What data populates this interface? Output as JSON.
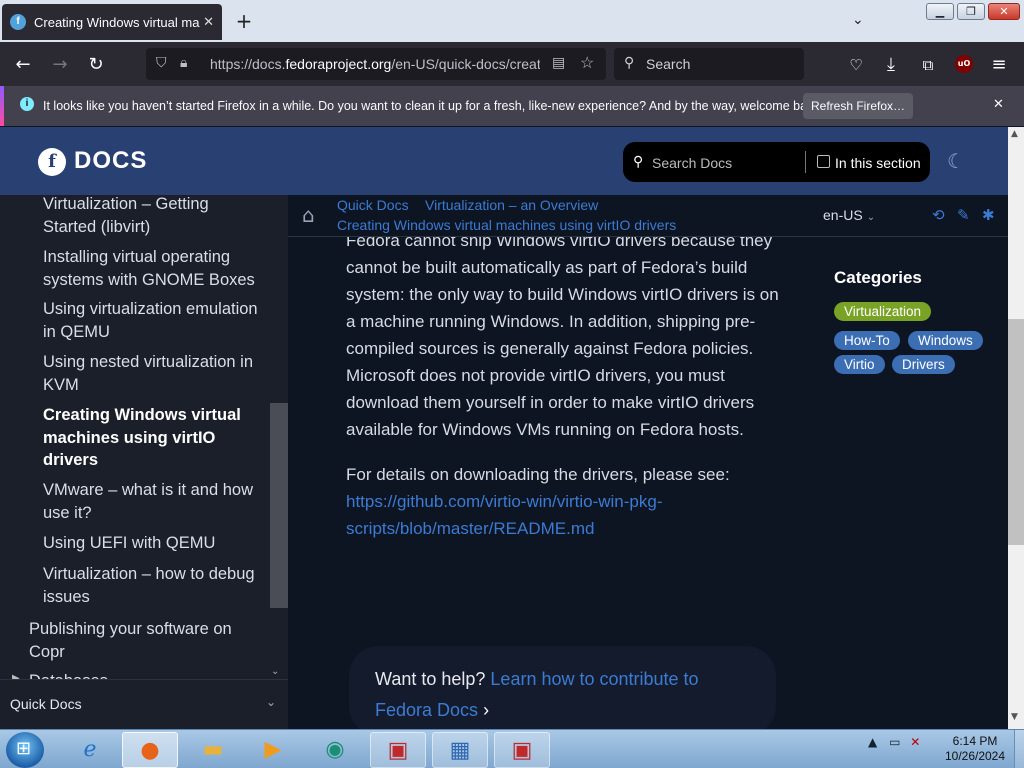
{
  "browser": {
    "tab_title": "Creating Windows virtual machines using virtIO drivers",
    "new_tab": "+",
    "url_prefix": "https://docs.",
    "url_domain": "fedoraproject.org",
    "url_rest": "/en-US/quick-docs/creating-windows-virtual-machines-using-virtio-drivers/",
    "search_placeholder": "Search",
    "ublock_label": "uO"
  },
  "notification": {
    "message": "It looks like you haven’t started Firefox in a while. Do you want to clean it up for a fresh, like-new experience? And by the way, welcome back!",
    "button": "Refresh Firefox…"
  },
  "site": {
    "logo_text": "DOCS",
    "search_placeholder": "Search Docs",
    "in_section_label": "In this section"
  },
  "sidebar": {
    "items": [
      {
        "label": "Virtualization – Getting Started (libvirt)"
      },
      {
        "label": "Installing virtual operating systems with GNOME Boxes"
      },
      {
        "label": "Using virtualization emulation in QEMU"
      },
      {
        "label": "Using nested virtualization in KVM"
      },
      {
        "label": "Creating Windows virtual machines using virtIO drivers"
      },
      {
        "label": "VMware – what is it and how use it?"
      },
      {
        "label": "Using UEFI with QEMU"
      },
      {
        "label": "Virtualization – how to debug issues"
      },
      {
        "label": "Publishing your software on Copr"
      },
      {
        "label": "Databases"
      }
    ],
    "footer_label": "Quick Docs"
  },
  "breadcrumb": {
    "items": [
      "Quick Docs",
      "Virtualization – an Overview",
      "Creating Windows virtual machines using virtIO drivers"
    ],
    "language": "en-US"
  },
  "article": {
    "paragraph1": "Fedora cannot ship Windows virtIO drivers because they cannot be built automatically as part of Fedora’s build system: the only way to build Windows virtIO drivers is on a machine running Windows. In addition, shipping pre-compiled sources is generally against Fedora policies. Microsoft does not provide virtIO drivers, you must download them yourself in order to make virtIO drivers available for Windows VMs run­ning on Fedora hosts.",
    "paragraph2": "For details on downloading the drivers, please see:",
    "link": "https://github.com/virtio-win/virtio-win-pkg-scripts/blob/master/README.md"
  },
  "categories": {
    "heading": "Categories",
    "tags": [
      "Virtualization",
      "How-To",
      "Windows",
      "Virtio",
      "Drivers"
    ]
  },
  "help": {
    "prefix": "Want to help?",
    "link": "Learn how to contribute to Fedora Docs",
    "arrow": "›"
  },
  "taskbar": {
    "time": "6:14 PM",
    "date": "10/26/2024"
  },
  "colors": {
    "fedora_blue": "#294172",
    "link_blue": "#3c7bd3",
    "tag_green": "#79a326",
    "tag_blue": "#3c6eb4"
  }
}
